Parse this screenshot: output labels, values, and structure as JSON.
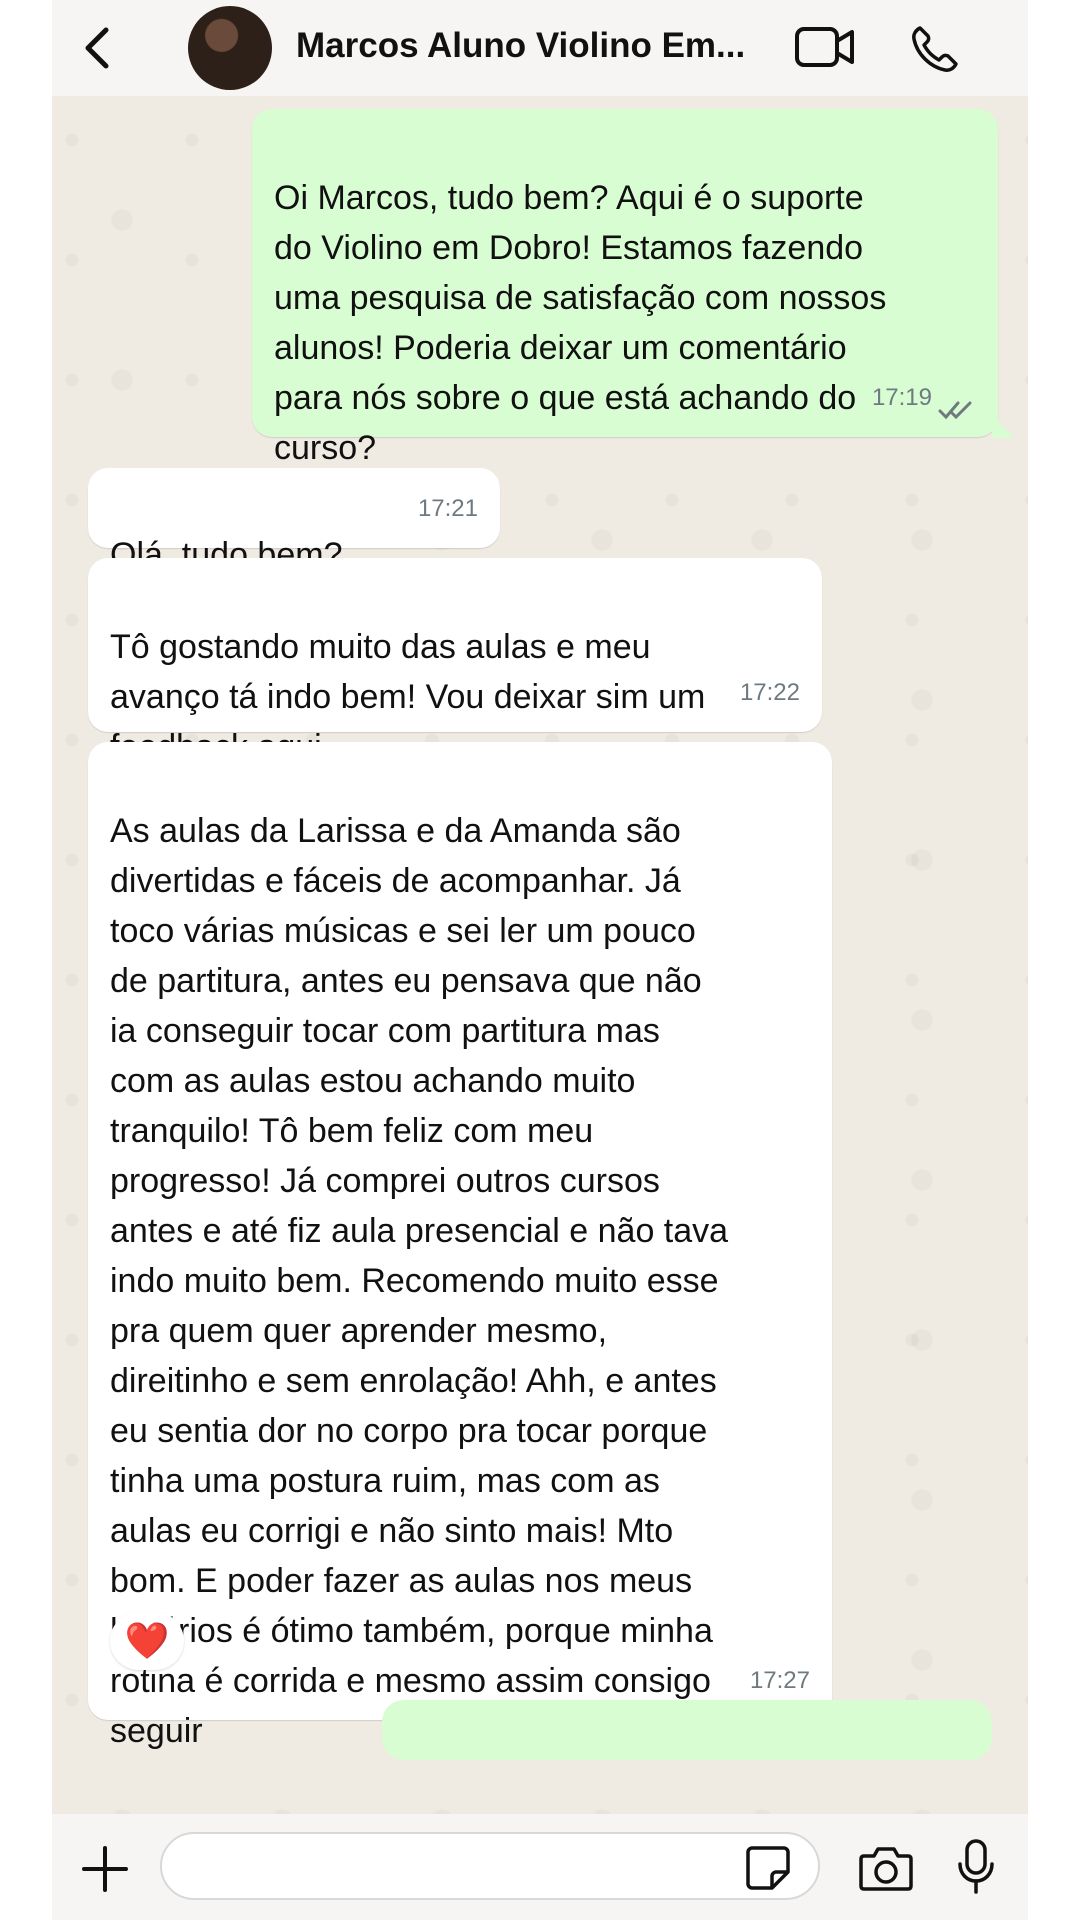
{
  "header": {
    "contact_name": "Marcos Aluno Violino Em..."
  },
  "messages": [
    {
      "direction": "outgoing",
      "text": "Oi Marcos, tudo bem? Aqui é o suporte\ndo Violino em Dobro! Estamos fazendo\numa pesquisa de satisfação com nossos\nalunos! Poderia deixar um comentário\npara nós sobre o que está achando do\ncurso?",
      "time": "17:19",
      "status": "read"
    },
    {
      "direction": "incoming",
      "text": "Olá, tudo bem?",
      "time": "17:21"
    },
    {
      "direction": "incoming",
      "text": "Tô gostando muito das aulas e meu\navanço tá indo bem! Vou deixar sim um\nfeedback aqui",
      "time": "17:22"
    },
    {
      "direction": "incoming",
      "text": "As aulas da Larissa e da Amanda são\ndivertidas e fáceis de acompanhar.  Já\ntoco várias músicas e sei ler um pouco\nde partitura, antes eu pensava que não\nia conseguir tocar com partitura mas\ncom as aulas estou achando muito\ntranquilo! Tô bem feliz com meu\nprogresso! Já comprei outros cursos\nantes e até fiz aula presencial e não tava\nindo muito bem. Recomendo muito esse\npra quem quer aprender mesmo,\ndireitinho e sem enrolação! Ahh, e antes\neu sentia dor no corpo pra tocar porque\ntinha uma postura ruim, mas com as\naulas eu corrigi e não sinto mais! Mto\nbom. E poder fazer as aulas nos meus\nhorários é ótimo também, porque minha\nrotina é corrida e mesmo assim consigo\nseguir",
      "time": "17:27",
      "reaction": "❤️"
    }
  ],
  "composer": {
    "value": "",
    "placeholder": ""
  },
  "colors": {
    "outgoing_bubble": "#d9fdd3",
    "incoming_bubble": "#ffffff",
    "chat_background": "#efeae2",
    "read_ticks": "#6f7a80"
  },
  "icons": {
    "back": "chevron-left-icon",
    "video": "video-camera-icon",
    "call": "phone-icon",
    "attach": "plus-icon",
    "sticker": "sticker-icon",
    "camera": "camera-icon",
    "mic": "microphone-icon"
  }
}
